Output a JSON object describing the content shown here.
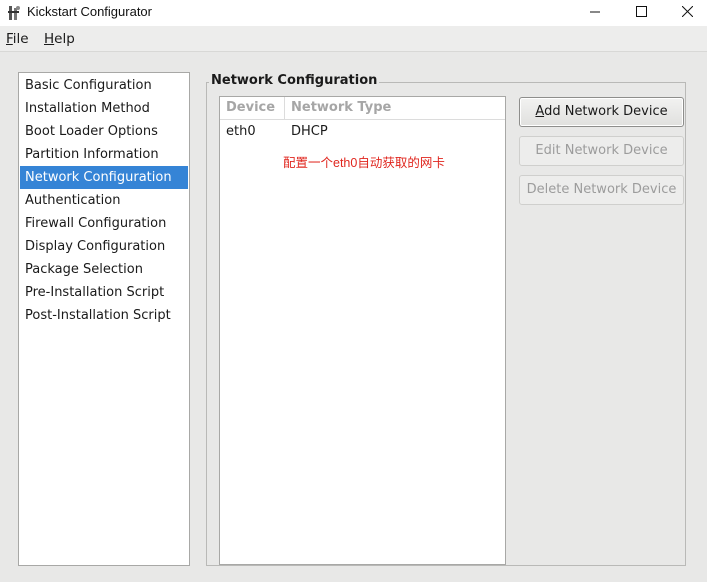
{
  "window": {
    "title": "Kickstart Configurator",
    "controls": {
      "minimize_icon": "minimize-icon",
      "maximize_icon": "maximize-icon",
      "close_icon": "close-icon"
    }
  },
  "menubar": {
    "file": {
      "mnemonic": "F",
      "rest": "ile"
    },
    "help": {
      "mnemonic": "H",
      "rest": "elp"
    }
  },
  "sidebar": {
    "items": [
      {
        "label": "Basic Configuration"
      },
      {
        "label": "Installation Method"
      },
      {
        "label": "Boot Loader Options"
      },
      {
        "label": "Partition Information"
      },
      {
        "label": "Network Configuration",
        "selected": true
      },
      {
        "label": "Authentication"
      },
      {
        "label": "Firewall Configuration"
      },
      {
        "label": "Display Configuration"
      },
      {
        "label": "Package Selection"
      },
      {
        "label": "Pre-Installation Script"
      },
      {
        "label": "Post-Installation Script"
      }
    ]
  },
  "network": {
    "frame_title": "Network Configuration",
    "table": {
      "columns": [
        "Device",
        "Network Type"
      ],
      "rows": [
        {
          "device": "eth0",
          "type": "DHCP"
        }
      ]
    },
    "annotation": "配置一个eth0自动获取的网卡",
    "buttons": {
      "add": {
        "mnemonic": "A",
        "rest": "dd Network Device",
        "enabled": true
      },
      "edit": {
        "label": "Edit Network Device",
        "enabled": false
      },
      "delete": {
        "label": "Delete Network Device",
        "enabled": false
      }
    }
  },
  "colors": {
    "selection": "#3584d6",
    "annotation": "#e0271f",
    "window_bg": "#e8e8e7"
  }
}
